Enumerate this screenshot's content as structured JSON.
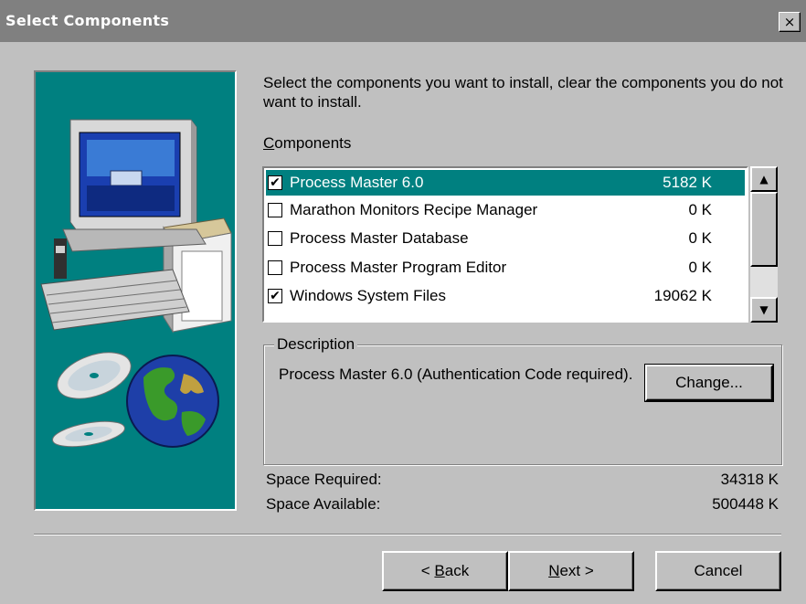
{
  "window": {
    "title": "Select Components",
    "close_glyph": "×"
  },
  "intro_text": "Select the components you want to install, clear the components you do not want to install.",
  "components_label": "Components",
  "components": [
    {
      "checked": true,
      "name": "Process Master 6.0",
      "size": "5182 K",
      "selected": true
    },
    {
      "checked": false,
      "name": "Marathon Monitors Recipe Manager",
      "size": "0 K",
      "selected": false
    },
    {
      "checked": false,
      "name": "Process Master Database",
      "size": "0 K",
      "selected": false
    },
    {
      "checked": false,
      "name": "Process Master Program Editor",
      "size": "0 K",
      "selected": false
    },
    {
      "checked": true,
      "name": "Windows System Files",
      "size": "19062 K",
      "selected": false
    }
  ],
  "scrollbar": {
    "up_glyph": "▲",
    "down_glyph": "▼"
  },
  "description": {
    "legend": "Description",
    "text": "Process Master 6.0 (Authentication Code required).",
    "change_button": "Change..."
  },
  "space": {
    "required_label": "Space Required:",
    "required_value": "34318 K",
    "available_label": "Space Available:",
    "available_value": "500448 K"
  },
  "buttons": {
    "back": "Back",
    "next": "Next",
    "cancel": "Cancel"
  },
  "colors": {
    "teal": "#008080",
    "dialog_bg": "#c0c0c0",
    "titlebar": "#808080"
  },
  "icons": [
    "computer-illustration",
    "globe-icon",
    "cd-disc-icon",
    "checkbox-check-icon",
    "close-icon",
    "scroll-up-arrow-icon",
    "scroll-down-arrow-icon"
  ]
}
